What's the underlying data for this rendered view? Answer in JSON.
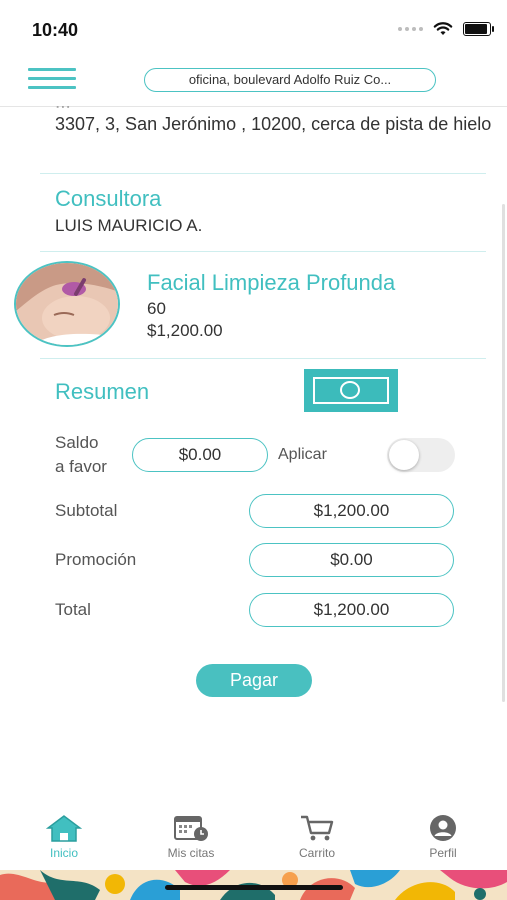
{
  "status_bar": {
    "time": "10:40"
  },
  "header": {
    "address": "oficina, boulevard Adolfo Ruiz Co..."
  },
  "address_block": {
    "cut_line": "...",
    "text": "3307, 3, San Jerónimo , 10200, cerca de pista de hielo"
  },
  "consultant": {
    "title": "Consultora",
    "name": "LUIS MAURICIO A."
  },
  "service": {
    "title": "Facial Limpieza Profunda",
    "duration": "60",
    "price": "$1,200.00"
  },
  "summary": {
    "title": "Resumen",
    "balance_label_1": "Saldo",
    "balance_label_2": "a favor",
    "balance_value": "$0.00",
    "apply_label": "Aplicar",
    "apply_enabled": false,
    "subtotal_label": "Subtotal",
    "subtotal_value": "$1,200.00",
    "promo_label": "Promoción",
    "promo_value": "$0.00",
    "total_label": "Total",
    "total_value": "$1,200.00"
  },
  "pay_button": "Pagar",
  "tabs": [
    {
      "label": "Inicio",
      "icon": "home-icon",
      "active": true
    },
    {
      "label": "Mis citas",
      "icon": "calendar-clock-icon",
      "active": false
    },
    {
      "label": "Carrito",
      "icon": "cart-icon",
      "active": false
    },
    {
      "label": "Perfil",
      "icon": "profile-icon",
      "active": false
    }
  ],
  "colors": {
    "accent": "#41bfc0",
    "accent_dark": "#3cbbbb",
    "text": "#333333"
  }
}
